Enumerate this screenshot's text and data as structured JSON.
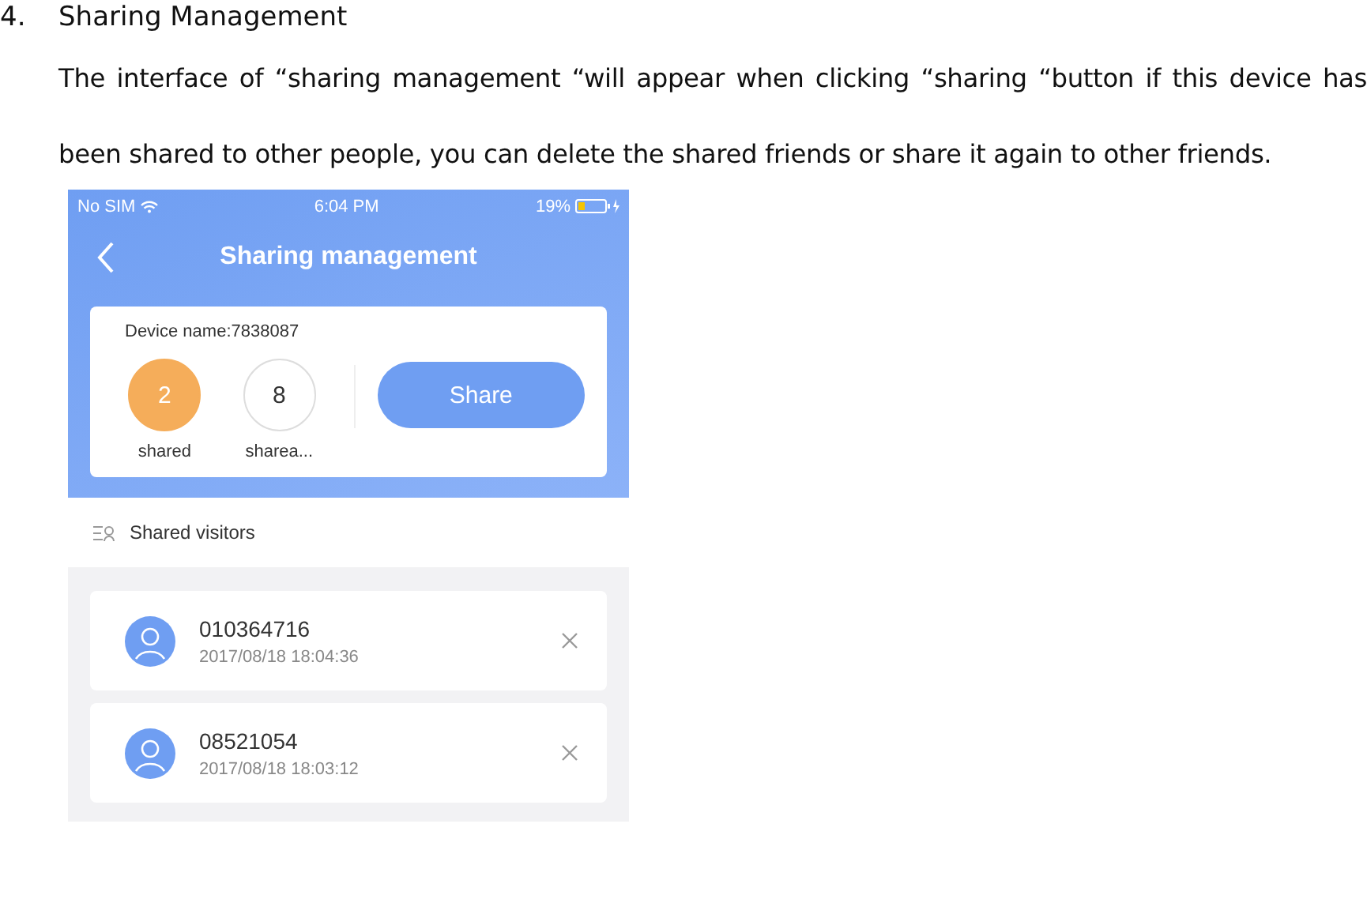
{
  "section": {
    "number": "4.",
    "title": "Sharing Management"
  },
  "paragraph": "The interface of “sharing management “will appear when clicking “sharing “button if this device has been shared to other people, you can delete the shared friends or share it again to other friends.",
  "phone": {
    "status_bar": {
      "carrier": "No SIM",
      "time": "6:04 PM",
      "battery": "19%"
    },
    "title": "Sharing management",
    "device_label": "Device name:7838087",
    "counters": [
      {
        "value": "2",
        "label": "shared",
        "selected": true
      },
      {
        "value": "8",
        "label": "sharea...",
        "selected": false
      }
    ],
    "share_button": "Share",
    "list_heading": "Shared visitors",
    "visitors": [
      {
        "id": "010364716",
        "time": "2017/08/18 18:04:36"
      },
      {
        "id": "08521054",
        "time": "2017/08/18 18:03:12"
      }
    ]
  }
}
